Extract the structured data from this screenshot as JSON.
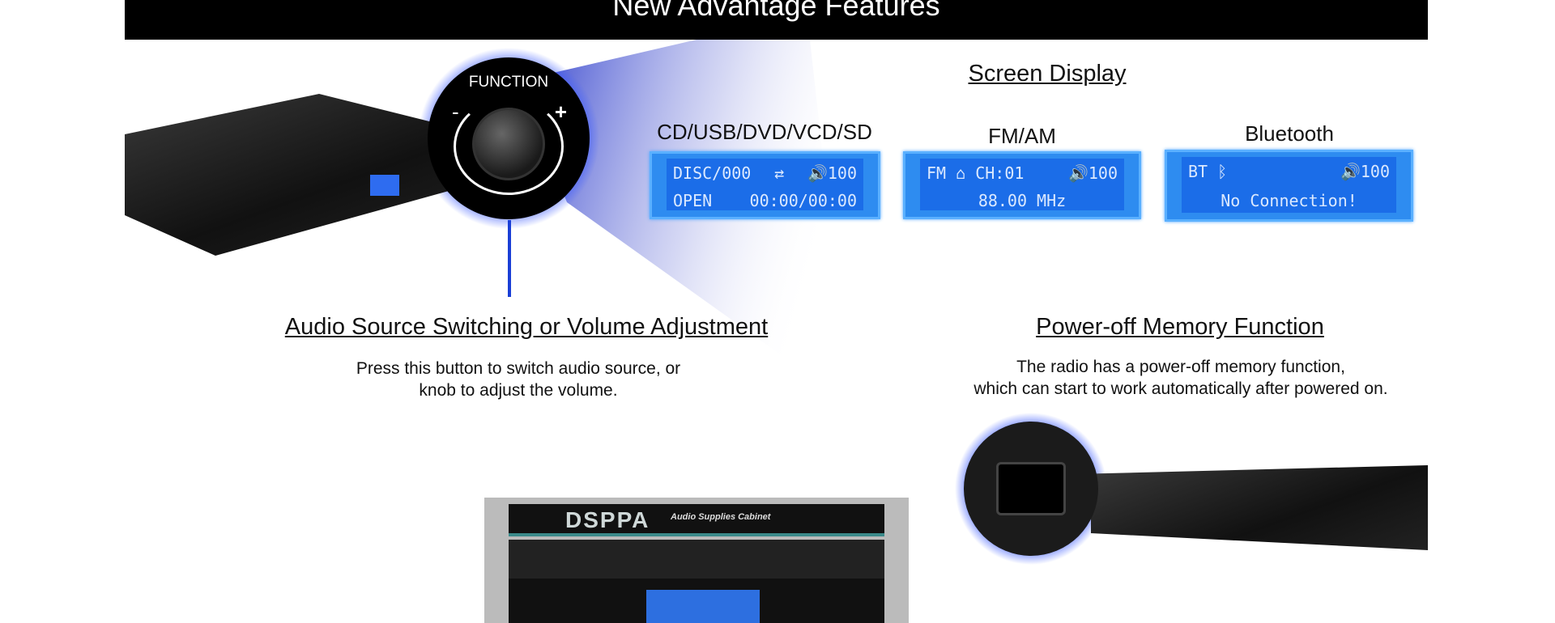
{
  "header": {
    "title": "New Advantage Features"
  },
  "knob": {
    "label": "FUNCTION",
    "minus": "-",
    "plus": "+"
  },
  "screen_display": {
    "title": "Screen Display",
    "screens": [
      {
        "label": "CD/USB/DVD/VCD/SD",
        "line1_left": "DISC/000",
        "line1_mid": "⇄",
        "line1_right": "🔊100",
        "line2_left": "OPEN",
        "line2_right": "00:00/00:00"
      },
      {
        "label": "FM/AM",
        "line1_left": "FM ⌂ CH:01",
        "line1_right": "🔊100",
        "line2": "88.00 MHz"
      },
      {
        "label": "Bluetooth",
        "line1_left": "BT ᛒ",
        "line1_right": "🔊100",
        "line2": "No Connection!"
      }
    ]
  },
  "audio_source": {
    "title": "Audio Source Switching or Volume Adjustment",
    "desc_line1": "Press this button to switch audio source, or",
    "desc_line2": "knob to adjust the volume."
  },
  "power_off": {
    "title": "Power-off Memory Function",
    "desc_line1": "The radio has a power-off memory function,",
    "desc_line2": "which can start to work automatically after powered on."
  },
  "rack": {
    "brand": "DSPPA",
    "subtitle": "Audio Supplies Cabinet"
  },
  "colors": {
    "accent_blue": "#1a3fd6",
    "lcd_blue": "#2e8cf0"
  }
}
